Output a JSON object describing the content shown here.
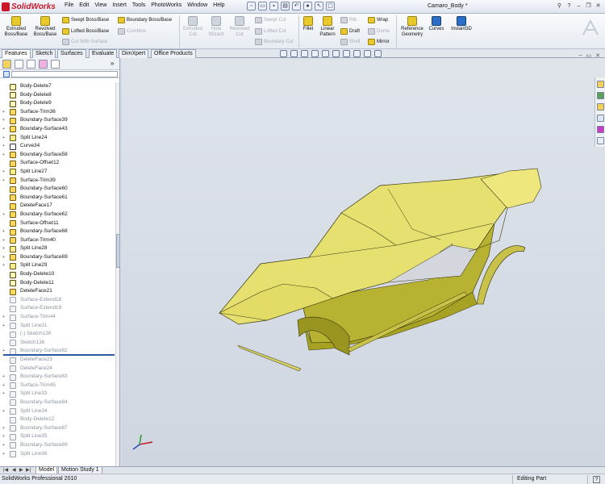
{
  "app": {
    "logo_text": "SolidWorks",
    "menus": [
      "File",
      "Edit",
      "View",
      "Insert",
      "Tools",
      "PhotoWorks",
      "Window",
      "Help"
    ],
    "document_title": "Camaro_Body *",
    "colors": {
      "brand": "#c8182a",
      "surface_yellow": "#e8e070",
      "viewport_bg": "#d4dce8"
    }
  },
  "ribbon": {
    "extruded": "Extruded Boss/Base",
    "revolved": "Revolved Boss/Base",
    "swept": "Swept Boss/Base",
    "lofted": "Lofted Boss/Base",
    "cut_with_surface": "Cut With Surface",
    "boundary": "Boundary Boss/Base",
    "combine": "Combine",
    "extruded_cut": "Extruded Cut",
    "hole_wizard": "Hole Wizard",
    "revolved_cut": "Revolved Cut",
    "swept_cut": "Swept Cut",
    "lofted_cut": "Lofted Cut",
    "boundary_cut": "Boundary Cut",
    "fillet": "Fillet",
    "linear_pattern": "Linear Pattern",
    "rib": "Rib",
    "draft": "Draft",
    "shell": "Shell",
    "wrap": "Wrap",
    "dome": "Dome",
    "mirror": "Mirror",
    "reference_geometry": "Reference Geometry",
    "curves": "Curves",
    "instant3d": "Instant3D"
  },
  "tabs": [
    "Features",
    "Sketch",
    "Surfaces",
    "Evaluate",
    "DimXpert",
    "Office Products"
  ],
  "tree": {
    "active": [
      {
        "label": "Body-Delete7",
        "icon": "body"
      },
      {
        "label": "Body-Delete8",
        "icon": "body"
      },
      {
        "label": "Body-Delete9",
        "icon": "body"
      },
      {
        "label": "Surface-Trim36",
        "icon": "surf",
        "expand": true
      },
      {
        "label": "Boundary-Surface39",
        "icon": "surf",
        "expand": true
      },
      {
        "label": "Boundary-Surface43",
        "icon": "surf",
        "expand": true
      },
      {
        "label": "Split Line24",
        "icon": "split",
        "expand": true
      },
      {
        "label": "Curve34",
        "icon": "sketch",
        "expand": true
      },
      {
        "label": "Boundary-Surface58",
        "icon": "surf",
        "expand": true
      },
      {
        "label": "Surface-Offset12",
        "icon": "surf"
      },
      {
        "label": "Split Line27",
        "icon": "split",
        "expand": true
      },
      {
        "label": "Surface-Trim39",
        "icon": "surf",
        "expand": true
      },
      {
        "label": "Boundary-Surface60",
        "icon": "surf"
      },
      {
        "label": "Boundary-Surface61",
        "icon": "surf"
      },
      {
        "label": "DeleteFace17",
        "icon": "surf"
      },
      {
        "label": "Boundary-Surface62",
        "icon": "surf",
        "expand": true
      },
      {
        "label": "Surface-Offset11",
        "icon": "surf"
      },
      {
        "label": "Boundary-Surface68",
        "icon": "surf",
        "expand": true
      },
      {
        "label": "Surface-Trim40",
        "icon": "surf",
        "expand": true
      },
      {
        "label": "Split Line28",
        "icon": "split",
        "expand": true
      },
      {
        "label": "Boundary-Surface69",
        "icon": "surf",
        "expand": true
      },
      {
        "label": "Split Line29",
        "icon": "split",
        "expand": true
      },
      {
        "label": "Body-Delete10",
        "icon": "body"
      },
      {
        "label": "Body-Delete11",
        "icon": "body"
      },
      {
        "label": "DeleteFace21",
        "icon": "surf"
      }
    ],
    "suppressed": [
      {
        "label": "Surface-Extend18",
        "icon": "surf"
      },
      {
        "label": "Surface-Extend19",
        "icon": "surf"
      },
      {
        "label": "Surface-Trim44",
        "icon": "surf",
        "expand": true
      },
      {
        "label": "Split Line31",
        "icon": "split",
        "expand": true
      },
      {
        "label": "(-) Sketch130",
        "icon": "sketch"
      },
      {
        "label": "Sketch136",
        "icon": "sketch"
      },
      {
        "label": "Boundary-Surface82",
        "icon": "surf",
        "expand": true
      },
      {
        "label": "DeleteFace23",
        "icon": "surf"
      },
      {
        "label": "DeleteFace24",
        "icon": "surf"
      },
      {
        "label": "Boundary-Surface83",
        "icon": "surf",
        "expand": true
      },
      {
        "label": "Surface-Trim45",
        "icon": "surf",
        "expand": true
      },
      {
        "label": "Split Line33",
        "icon": "split",
        "expand": true
      },
      {
        "label": "Boundary-Surface84",
        "icon": "surf"
      },
      {
        "label": "Split Line34",
        "icon": "split",
        "expand": true
      },
      {
        "label": "Body-Delete12",
        "icon": "body"
      },
      {
        "label": "Boundary-Surface87",
        "icon": "surf",
        "expand": true
      },
      {
        "label": "Split Line35",
        "icon": "split",
        "expand": true
      },
      {
        "label": "Boundary-Surface89",
        "icon": "surf",
        "expand": true
      },
      {
        "label": "Split Line36",
        "icon": "split",
        "expand": true
      }
    ]
  },
  "bottom_tabs": [
    "Model",
    "Motion Study 1"
  ],
  "status": {
    "left": "SolidWorks Professional 2010",
    "right": "Editing Part",
    "help": "?"
  }
}
